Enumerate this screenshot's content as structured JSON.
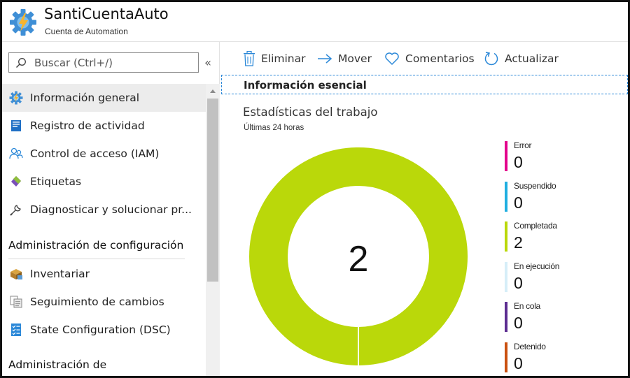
{
  "header": {
    "title": "SantiCuentaAuto",
    "subtitle": "Cuenta de Automation",
    "logo_icon": "automation-gear-icon"
  },
  "sidebar": {
    "search": {
      "placeholder": "Buscar (Ctrl+/)",
      "value": ""
    },
    "collapse_label": "«",
    "items": [
      {
        "label": "Información general",
        "icon": "gear-icon",
        "active": true
      },
      {
        "label": "Registro de actividad",
        "icon": "activity-log-icon",
        "active": false
      },
      {
        "label": "Control de acceso (IAM)",
        "icon": "users-icon",
        "active": false
      },
      {
        "label": "Etiquetas",
        "icon": "tag-icon",
        "active": false
      },
      {
        "label": "Diagnosticar y solucionar pr...",
        "icon": "wrench-icon",
        "active": false
      }
    ],
    "section_config": {
      "title": "Administración de configuración",
      "items": [
        {
          "label": "Inventariar",
          "icon": "inventory-icon"
        },
        {
          "label": "Seguimiento de cambios",
          "icon": "change-tracking-icon"
        },
        {
          "label": "State Configuration (DSC)",
          "icon": "checklist-icon"
        }
      ]
    },
    "section_next_title": "Administración de"
  },
  "toolbar": {
    "delete_label": "Eliminar",
    "move_label": "Mover",
    "feedback_label": "Comentarios",
    "refresh_label": "Actualizar"
  },
  "essentials": {
    "label": "Información esencial"
  },
  "job_stats": {
    "title": "Estadísticas del trabajo",
    "subtitle": "Últimas 24 horas",
    "total": "2"
  },
  "chart_data": {
    "type": "pie",
    "categories": [
      "Error",
      "Suspendido",
      "Completada",
      "En ejecución",
      "En cola",
      "Detenido"
    ],
    "values": [
      0,
      0,
      2,
      0,
      0,
      0
    ],
    "colors": [
      "#e3008c",
      "#1faee0",
      "#bad80a",
      "#d6eef8",
      "#5c2d91",
      "#ca5010"
    ],
    "center_label": "2",
    "legend_placement": "right"
  }
}
